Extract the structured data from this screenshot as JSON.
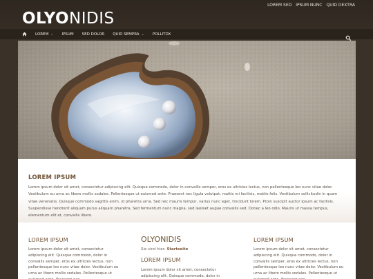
{
  "header": {
    "logo_bold": "OLYO",
    "logo_light": "NIDIS",
    "top_links": [
      "LOREM SED",
      "IPSUM NUNC",
      "QUID DEXTRA"
    ]
  },
  "nav": {
    "items": [
      {
        "label": "LOREM",
        "dropdown": true
      },
      {
        "label": "IPSUM",
        "dropdown": false
      },
      {
        "label": "SED DOLOR",
        "dropdown": false
      },
      {
        "label": "QUID SEMPRA",
        "dropdown": true
      },
      {
        "label": "POLLITOX",
        "dropdown": false
      }
    ]
  },
  "hero": {
    "image": "pearl-oyster-on-sand"
  },
  "intro": {
    "title": "LOREM IPSUM",
    "text": "Lorem ipsum dolor sit amet, consectetur adipiscing elit. Quisque commodo, dolor in convallis semper, eros ex ultricies lectus, non pellentesque leo nunc vitae dolor. Vestibulum eu urna ac libero mollis sodales. Pellentesque ut euismod ante. Praesent nec ligula volutpat, mattis mi facilisis, mattis felis. Vestibulum sollicitudin in quam vitae venenatis. Quisque commodo sagittis enim, id pharetra urna. Sed nec mauris tempor, varius nunc eget, tincidunt lorem. Proin suscipit auctor ipsum ac facilisis. Suspendisse hendrerit aliquam purus aliquam pharetra. Sed fermentum nunc magna, sed laoreet augue convallis sed. Donec a leo odio. Mauris ut massa tempus, elementum elit et, convallis libero."
  },
  "columns": {
    "left": {
      "title": "LOREM IPSUM",
      "text": "Lorem ipsum dolor sit amet, consectetur adipiscing elit. Quisque commodo, dolor in convallis semper, eros ex ultricies lectus, non pellentesque leo nunc vitae dolor. Vestibulum eu urna ac libero mollis sodales. Pellentesque ut euismod ante. Praesent nec"
    },
    "middle": {
      "big_title": "OLYONIDIS",
      "breadcrumb_prefix": "Sie sind hier:",
      "breadcrumb_link": "Startseite",
      "title": "LOREM IPSUM",
      "text": "Lorem ipsum dolor sit amet, consectetur adipiscing elit. Quisque commodo, dolor in convallis semper."
    },
    "right": {
      "title": "LOREM IPSUM",
      "text": "Lorem ipsum dolor sit amet, consectetur adipiscing elit. Quisque commodo, dolor in convallis semper, eros ex ultricies lectus, non pellentesque leo nunc vitae dolor. Vestibulum eu urna ac libero mollis sodales. Pellentesque ut euismod ante. Praesent nec"
    }
  },
  "colors": {
    "header_bg": "#2e2720",
    "nav_bg": "#2a231c",
    "heading": "#6f5236",
    "body_text": "#5a4f46"
  }
}
